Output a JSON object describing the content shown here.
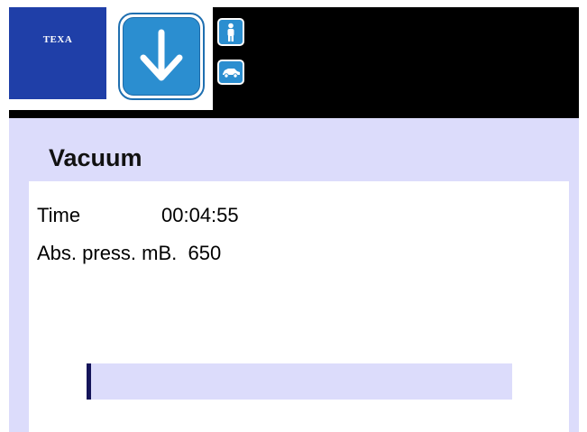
{
  "header": {
    "logo_text": "TEXA",
    "mode_icon": "arrow-down-icon",
    "side_buttons": [
      {
        "icon": "person-icon"
      },
      {
        "icon": "car-icon"
      }
    ]
  },
  "page": {
    "title": "Vacuum"
  },
  "readings": {
    "time_label": "Time",
    "time_value": "00:04:55",
    "pressure_label": "Abs. press. mB.",
    "pressure_value": "650"
  },
  "progress": {
    "fraction": 0.01
  },
  "colors": {
    "background": "#dcdcfb",
    "header": "#000000",
    "logo_blue": "#1f3fa8",
    "button_blue": "#2b8ed0",
    "progress_fill": "#14145a"
  }
}
